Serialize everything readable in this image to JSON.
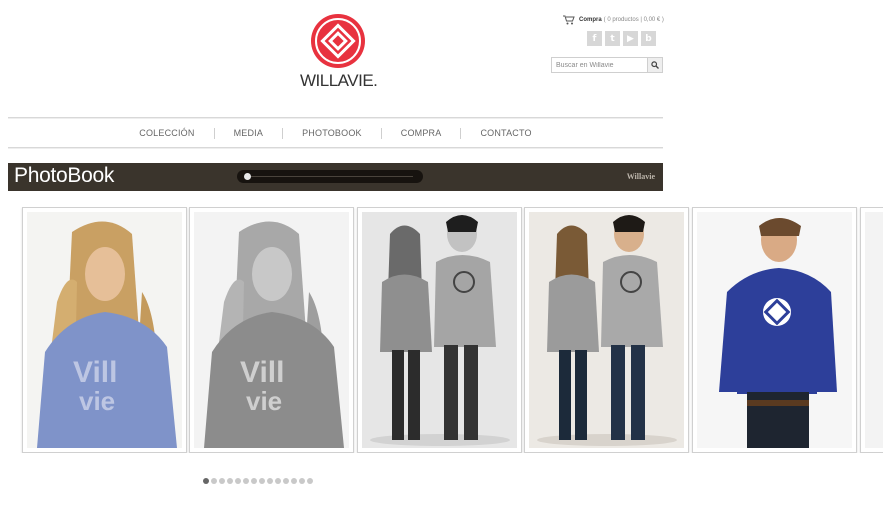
{
  "brand": {
    "name": "WILLAVIE.",
    "logo_color": "#e8323f"
  },
  "header": {
    "cart_label": "Compra",
    "cart_info": "( 0 productos | 0,00 € )",
    "socials": [
      {
        "icon": "facebook-icon",
        "glyph": "f"
      },
      {
        "icon": "twitter-icon",
        "glyph": "t"
      },
      {
        "icon": "youtube-icon",
        "glyph": "▶"
      },
      {
        "icon": "blog-icon",
        "glyph": "b"
      }
    ],
    "search_placeholder": "Buscar en Willavie"
  },
  "nav": {
    "items": [
      "COLECCIÓN",
      "MEDIA",
      "PHOTOBOOK",
      "COMPRA",
      "CONTACTO"
    ]
  },
  "gallery": {
    "title": "PhotoBook",
    "brand_label": "Willavie",
    "scroll_position": 0,
    "photos": [
      {
        "subject": "woman-blue-hoodie",
        "tone": "color"
      },
      {
        "subject": "woman-grey-hoodie",
        "tone": "bw"
      },
      {
        "subject": "couple",
        "tone": "bw"
      },
      {
        "subject": "couple",
        "tone": "color"
      },
      {
        "subject": "man-blue-hoodie",
        "tone": "color"
      },
      {
        "subject": "partial",
        "tone": "color"
      }
    ],
    "pagination": {
      "total": 14,
      "active": 0
    }
  },
  "colors": {
    "header_bar": "#3a342c",
    "accent": "#e8323f"
  }
}
